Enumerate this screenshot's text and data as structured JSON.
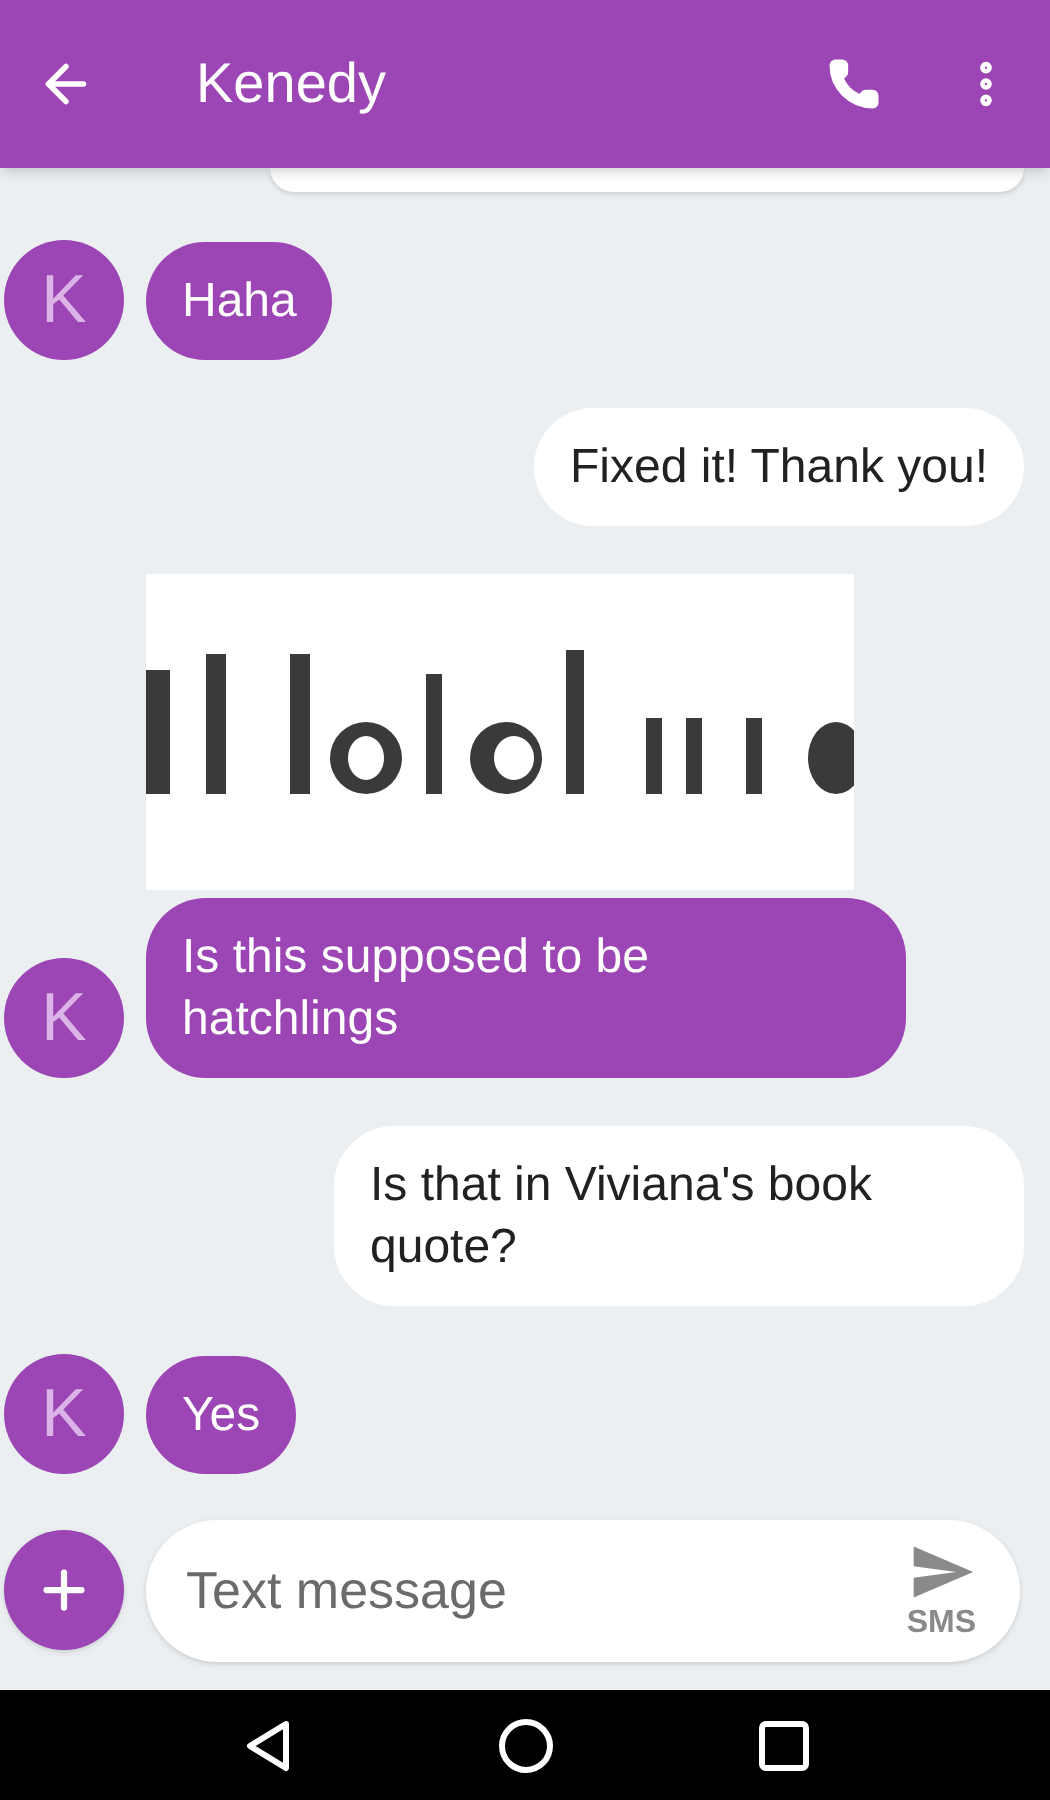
{
  "header": {
    "title": "Kenedy"
  },
  "messages": [
    {
      "kind": "clipped",
      "outgoing": true
    },
    {
      "kind": "text",
      "outgoing": false,
      "avatar": "K",
      "text": "Haha"
    },
    {
      "kind": "text",
      "outgoing": true,
      "text": "Fixed it! Thank you!"
    },
    {
      "kind": "image_text",
      "outgoing": false,
      "avatar": "K",
      "text": "Is this supposed to be hatchlings"
    },
    {
      "kind": "text",
      "outgoing": true,
      "text": "Is that in Viviana's book quote?"
    },
    {
      "kind": "text",
      "outgoing": false,
      "avatar": "K",
      "text": "Yes"
    }
  ],
  "composer": {
    "placeholder": "Text message",
    "send_label": "SMS"
  }
}
